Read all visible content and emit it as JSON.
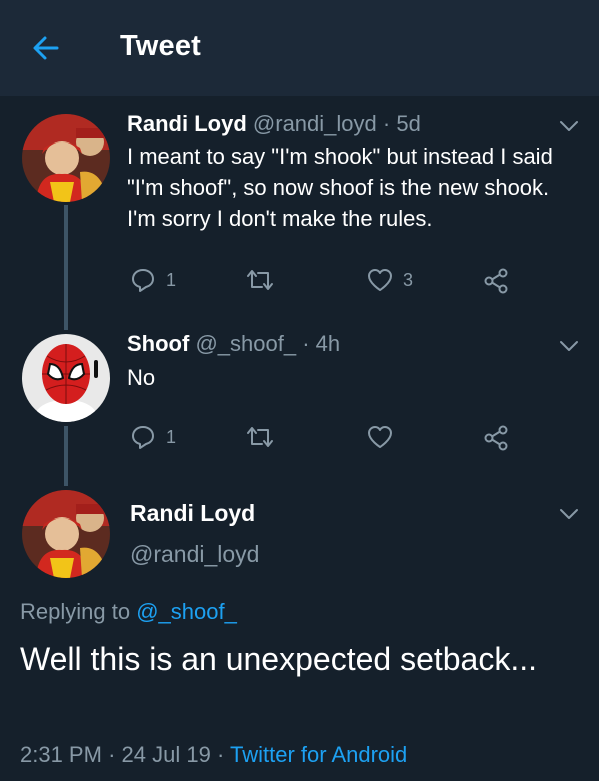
{
  "header": {
    "title": "Tweet",
    "back_icon": "arrow-left-icon"
  },
  "colors": {
    "background": "#15202b",
    "header": "#1c2938",
    "accent": "#1da1f2",
    "secondary_text": "#8899a6"
  },
  "tweets": [
    {
      "name": "Randi Loyd",
      "handle": "@randi_loyd",
      "separator": "·",
      "time": "5d",
      "text": "I meant to say \"I'm shook\" but instead I said \"I'm shoof\", so now shoof is the new shook. I'm sorry I don't make the rules.",
      "reply_count": "1",
      "retweet_count": "",
      "like_count": "3"
    },
    {
      "name": "Shoof",
      "handle": "@_shoof_",
      "separator": "·",
      "time": "4h",
      "text": "No",
      "reply_count": "1",
      "retweet_count": "",
      "like_count": ""
    }
  ],
  "main_tweet": {
    "name": "Randi Loyd",
    "handle": "@randi_loyd",
    "replying_prefix": "Replying to",
    "replying_to": "@_shoof_",
    "text": "Well this is an unexpected setback...",
    "time": "2:31 PM",
    "sep1": "·",
    "date": "24 Jul 19",
    "sep2": "·",
    "source": "Twitter for Android"
  }
}
